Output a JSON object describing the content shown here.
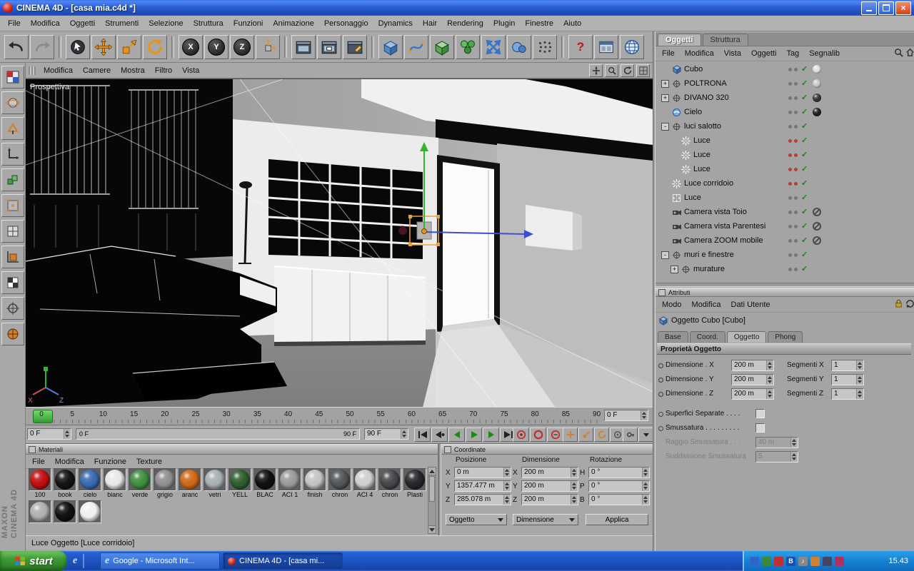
{
  "titlebar": {
    "title": "CINEMA 4D - [casa mia.c4d *]"
  },
  "menubar": {
    "items": [
      "File",
      "Modifica",
      "Oggetti",
      "Strumenti",
      "Selezione",
      "Struttura",
      "Funzioni",
      "Animazione",
      "Personaggio",
      "Dynamics",
      "Hair",
      "Rendering",
      "Plugin",
      "Finestre",
      "Aiuto"
    ]
  },
  "toolbar": {
    "lock_labels": {
      "x": "X",
      "y": "Y",
      "z": "Z"
    },
    "help_label": "?"
  },
  "viewport": {
    "label": "Prospettiva",
    "menu": [
      "Modifica",
      "Camere",
      "Mostra",
      "Filtro",
      "Vista"
    ]
  },
  "timeline": {
    "ticks": [
      "0",
      "5",
      "10",
      "15",
      "20",
      "25",
      "30",
      "35",
      "40",
      "45",
      "50",
      "55",
      "60",
      "65",
      "70",
      "75",
      "80",
      "85",
      "90"
    ],
    "current_frame": "0 F",
    "start_frame": "0 F",
    "end_frame": "90 F",
    "range_start": "0 F",
    "range_end": "90 F"
  },
  "materials": {
    "title": "Materiali",
    "menu": [
      "File",
      "Modifica",
      "Funzione",
      "Texture"
    ],
    "row1": [
      {
        "label": "100",
        "color": "#c01010"
      },
      {
        "label": "book",
        "color": "#141414"
      },
      {
        "label": "cielo",
        "color": "#3a6ab0"
      },
      {
        "label": "bianc",
        "color": "#e8e8e8"
      },
      {
        "label": "verde",
        "color": "#3f8f3f"
      },
      {
        "label": "grigio",
        "color": "#8f8f8f"
      },
      {
        "label": "aranc",
        "color": "#d06818"
      },
      {
        "label": "vetri",
        "color": "#a8b0b4"
      },
      {
        "label": "YELL",
        "color": "#2f5f2f"
      },
      {
        "label": "BLAC",
        "color": "#101010"
      },
      {
        "label": "ACI 1",
        "color": "#9a9a9a"
      },
      {
        "label": "finish",
        "color": "#c4c4c4"
      },
      {
        "label": "chron",
        "color": "#52565a"
      },
      {
        "label": "ACI 4",
        "color": "#cfcfcf"
      },
      {
        "label": "chron",
        "color": "#46484c"
      },
      {
        "label": "Plasti",
        "color": "#26282c"
      }
    ],
    "row2": [
      {
        "label": "",
        "color": "#b0b0b0"
      },
      {
        "label": "",
        "color": "#101010"
      },
      {
        "label": "",
        "color": "#f0f0f0"
      }
    ]
  },
  "coordinates": {
    "title": "Coordinate",
    "headers": [
      "Posizione",
      "Dimensione",
      "Rotazione"
    ],
    "position": [
      {
        "axis": "X",
        "value": "0 m"
      },
      {
        "axis": "Y",
        "value": "1357.477 m"
      },
      {
        "axis": "Z",
        "value": "285.078 m"
      }
    ],
    "dimension": [
      {
        "axis": "X",
        "value": "200 m"
      },
      {
        "axis": "Y",
        "value": "200 m"
      },
      {
        "axis": "Z",
        "value": "200 m"
      }
    ],
    "rotation": [
      {
        "axis": "H",
        "value": "0 °"
      },
      {
        "axis": "P",
        "value": "0 °"
      },
      {
        "axis": "B",
        "value": "0 °"
      }
    ],
    "mode_object": "Oggetto",
    "mode_dimension": "Dimensione",
    "apply_label": "Applica"
  },
  "object_manager": {
    "tabs": [
      "Oggetti",
      "Struttura"
    ],
    "active_tab": "Oggetti",
    "menu": [
      "File",
      "Modifica",
      "Vista",
      "Oggetti",
      "Tag",
      "Segnalib"
    ],
    "items": [
      {
        "label": "Cubo",
        "icon": "cube",
        "indent": 0,
        "expand": "",
        "check": true,
        "tag": "sphere",
        "tag_color": "#e0e0e0",
        "dots": "gray"
      },
      {
        "label": "POLTRONA",
        "icon": "null",
        "indent": 0,
        "expand": "+",
        "check": true,
        "tag": "sphere",
        "tag_color": "#c8c8c8",
        "dots": "gray"
      },
      {
        "label": "DIVANO 320",
        "icon": "null",
        "indent": 0,
        "expand": "+",
        "check": true,
        "tag": "sphere",
        "tag_color": "#383838",
        "dots": "gray"
      },
      {
        "label": "Cielo",
        "icon": "sky",
        "indent": 0,
        "expand": "",
        "check": true,
        "tag": "sphere",
        "tag_color": "#202020",
        "dots": "gray"
      },
      {
        "label": "luci salotto",
        "icon": "null",
        "indent": 0,
        "expand": "-",
        "check": true,
        "tag": "",
        "dots": "gray"
      },
      {
        "label": "Luce",
        "icon": "light",
        "indent": 1,
        "expand": "",
        "check": true,
        "tag": "",
        "dots": "red"
      },
      {
        "label": "Luce",
        "icon": "light",
        "indent": 1,
        "expand": "",
        "check": true,
        "tag": "",
        "dots": "red"
      },
      {
        "label": "Luce",
        "icon": "light",
        "indent": 1,
        "expand": "",
        "check": true,
        "tag": "",
        "dots": "red"
      },
      {
        "label": "Luce corridoio",
        "icon": "light",
        "indent": 0,
        "expand": "",
        "check": true,
        "tag": "",
        "dots": "red"
      },
      {
        "label": "Luce",
        "icon": "light-area",
        "indent": 0,
        "expand": "",
        "check": true,
        "tag": "",
        "dots": "gray"
      },
      {
        "label": "Camera vista Toio",
        "icon": "camera",
        "indent": 0,
        "expand": "",
        "check": true,
        "tag": "forbidden",
        "dots": "gray"
      },
      {
        "label": "Camera vista Parentesi",
        "icon": "camera",
        "indent": 0,
        "expand": "",
        "check": true,
        "tag": "forbidden",
        "dots": "gray"
      },
      {
        "label": "Camera ZOOM mobile",
        "icon": "camera",
        "indent": 0,
        "expand": "",
        "check": true,
        "tag": "forbidden",
        "dots": "gray"
      },
      {
        "label": "muri e finestre",
        "icon": "null",
        "indent": 0,
        "expand": "-",
        "check": true,
        "tag": "",
        "dots": "gray"
      },
      {
        "label": "murature",
        "icon": "null",
        "indent": 1,
        "expand": "+",
        "check": true,
        "tag": "",
        "dots": "gray"
      }
    ]
  },
  "attributes": {
    "title": "Attributi",
    "menu": [
      "Modo",
      "Modifica",
      "Dati Utente"
    ],
    "object_label": "Oggetto Cubo [Cubo]",
    "tabs": [
      "Base",
      "Coord.",
      "Oggetto",
      "Phong"
    ],
    "active_tab": "Oggetto",
    "section_title": "Proprietà Oggetto",
    "rows": [
      {
        "label": "Dimensione . X",
        "value": "200 m",
        "label2": "Segmenti X",
        "value2": "1"
      },
      {
        "label": "Dimensione . Y",
        "value": "200 m",
        "label2": "Segmenti Y",
        "value2": "1"
      },
      {
        "label": "Dimensione . Z",
        "value": "200 m",
        "label2": "Segmenti Z",
        "value2": "1"
      }
    ],
    "checks": [
      {
        "label": "Superfici Separate . . . ."
      },
      {
        "label": "Smussatura . . . . . . . . ."
      }
    ],
    "disabled_rows": [
      {
        "label": "Raggio Smussatura . . .",
        "value": "40 m"
      },
      {
        "label": "Suddivisione Smussatura",
        "value": "5"
      }
    ]
  },
  "statusbar": {
    "text": "Luce Oggetto [Luce corridoio]"
  },
  "brand": {
    "line1": "MAXON",
    "line2": "CINEMA 4D"
  },
  "taskbar": {
    "start_label": "start",
    "tasks": [
      {
        "label": "Google - Microsoft Int...",
        "active": false
      },
      {
        "label": "CINEMA 4D - [casa mi...",
        "active": true
      }
    ],
    "clock": "15.43"
  }
}
